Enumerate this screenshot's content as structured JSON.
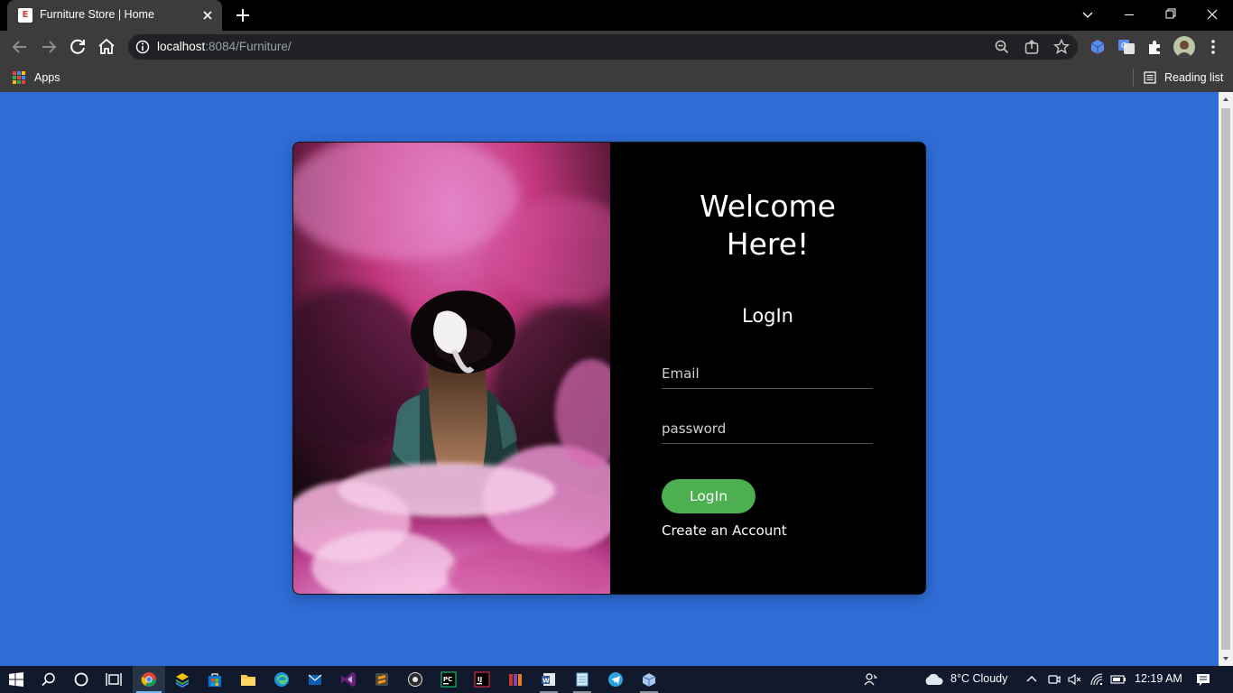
{
  "browser": {
    "tab_title": "Furniture Store | Home",
    "tab_favicon_letter": "E",
    "url_host": "localhost",
    "url_rest": ":8084/Furniture/",
    "bookmarks": {
      "apps_label": "Apps",
      "reading_list_label": "Reading list"
    }
  },
  "page": {
    "background_color": "#2f6cd6",
    "welcome_line1": "Welcome",
    "welcome_line2": "Here!",
    "form_title": "LogIn",
    "email_placeholder": "Email",
    "password_placeholder": "password",
    "login_button": "LogIn",
    "login_button_color": "#4caf50",
    "create_account_link": "Create an Account"
  },
  "taskbar": {
    "weather": "8°C  Cloudy",
    "time": "12:19 AM"
  }
}
